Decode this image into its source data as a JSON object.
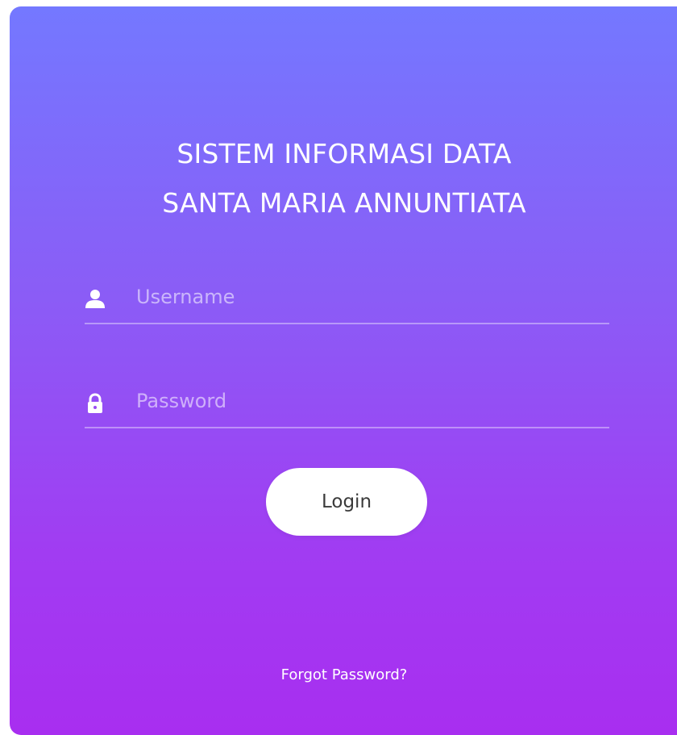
{
  "title": {
    "line1": "SISTEM INFORMASI DATA",
    "line2": "SANTA MARIA ANNUNTIATA"
  },
  "form": {
    "username_placeholder": "Username",
    "password_placeholder": "Password",
    "login_label": "Login",
    "forgot_label": "Forgot Password?"
  },
  "icons": {
    "username": "user-icon",
    "password": "lock-icon"
  },
  "colors": {
    "gradient_top": "#7478ff",
    "gradient_bottom": "#a82ef0",
    "button_bg": "#ffffff",
    "text": "#ffffff"
  }
}
